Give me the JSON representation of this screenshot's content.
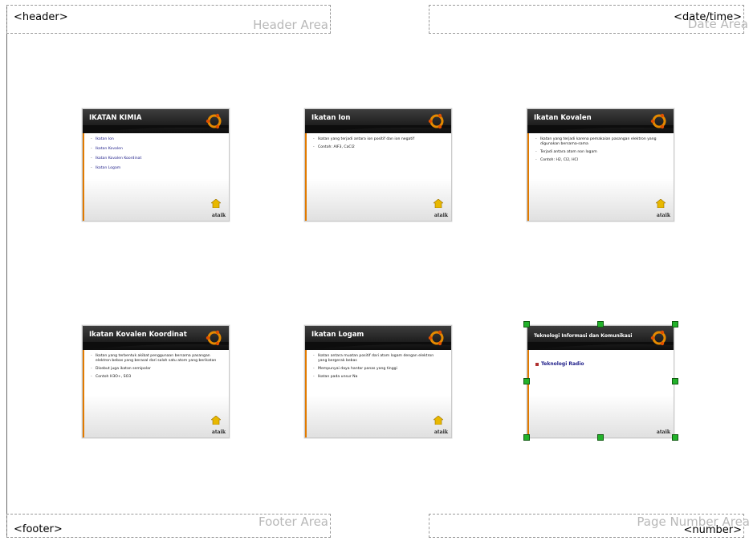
{
  "areas": {
    "header": {
      "placeholder": "<header>",
      "label": "Header Area"
    },
    "date": {
      "placeholder": "<date/time>",
      "label": "Date Area"
    },
    "footer": {
      "placeholder": "<footer>",
      "label": "Footer Area"
    },
    "number": {
      "placeholder": "<number>",
      "label": "Page Number Area"
    }
  },
  "brand_text": "ataik",
  "slides": [
    {
      "title": "IKATAN KIMIA",
      "items": [
        "Ikatan Ion",
        "Ikatan Kovalen",
        "Ikatan Kovalen Koordinat",
        "Ikatan Logam"
      ]
    },
    {
      "title": "Ikatan Ion",
      "items": [
        "Ikatan yang terjadi antara ion positif dan ion negatif",
        "Contoh: AlF3, CaCl2"
      ]
    },
    {
      "title": "Ikatan Kovalen",
      "items": [
        "Ikatan yang terjadi karena pemakaian pasangan elektron yang digunakan bersama-sama",
        "Terjadi antara atom non logam",
        "Contoh: H2, Cl2, HCl"
      ]
    },
    {
      "title": "Ikatan Kovalen Koordinat",
      "items": [
        "Ikatan yang terbentuk akibat penggunaan bersama pasangan elektron bebas yang berasal dari salah satu atom yang berikatan",
        "Disebut juga ikatan semipolar",
        "Contoh H3O+, SO3"
      ]
    },
    {
      "title": "Ikatan Logam",
      "items": [
        "Ikatan antara muatan positif dari atom logam dengan elektron yang bergerak bebas",
        "Mempunyai daya hantar panas yang tinggi",
        "Ikatan pada unsur Na"
      ]
    },
    {
      "title": "Teknologi Informasi dan Komunikasi",
      "items": [
        "Teknologi Radio"
      ]
    }
  ],
  "colors": {
    "accent": "#e17a00",
    "selection_handle": "#22b22a",
    "link": "#20208a"
  }
}
